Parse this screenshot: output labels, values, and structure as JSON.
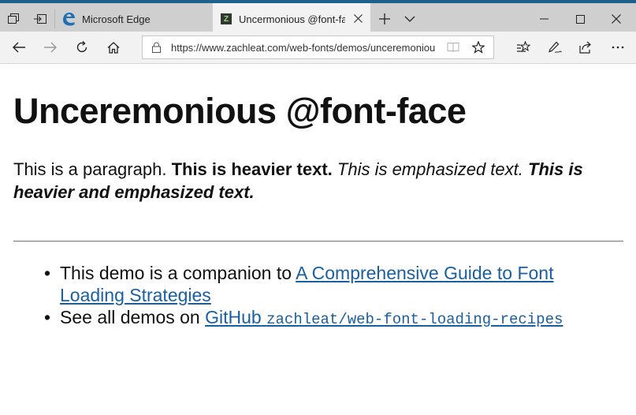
{
  "browser": {
    "tabs": [
      {
        "title": "Microsoft Edge",
        "active": false,
        "icon": "edge-logo-icon"
      },
      {
        "title": "Uncermonious @font-fa",
        "active": true,
        "icon": "zachleat-favicon-icon"
      }
    ],
    "favicon_letter": "Z",
    "address_bar": {
      "url": "https://www.zachleat.com/web-fonts/demos/unceremoniou"
    },
    "accent_color": "#1f5f8c"
  },
  "page": {
    "heading": "Unceremonious @font-face",
    "paragraph": {
      "normal": "This is a paragraph.",
      "heavier": "This is heavier text.",
      "emphasized": "This is emphasized text.",
      "heavier_emphasized": "This is heavier and emphasized text."
    },
    "list": [
      {
        "prefix": "This demo is a companion to",
        "link_text": "A Comprehensive Guide to Font Loading Strategies"
      },
      {
        "prefix": "See all demos on",
        "link_text": "GitHub",
        "code_text": "zachleat/web-font-loading-recipes"
      }
    ],
    "link_color": "#1a5fa0"
  }
}
